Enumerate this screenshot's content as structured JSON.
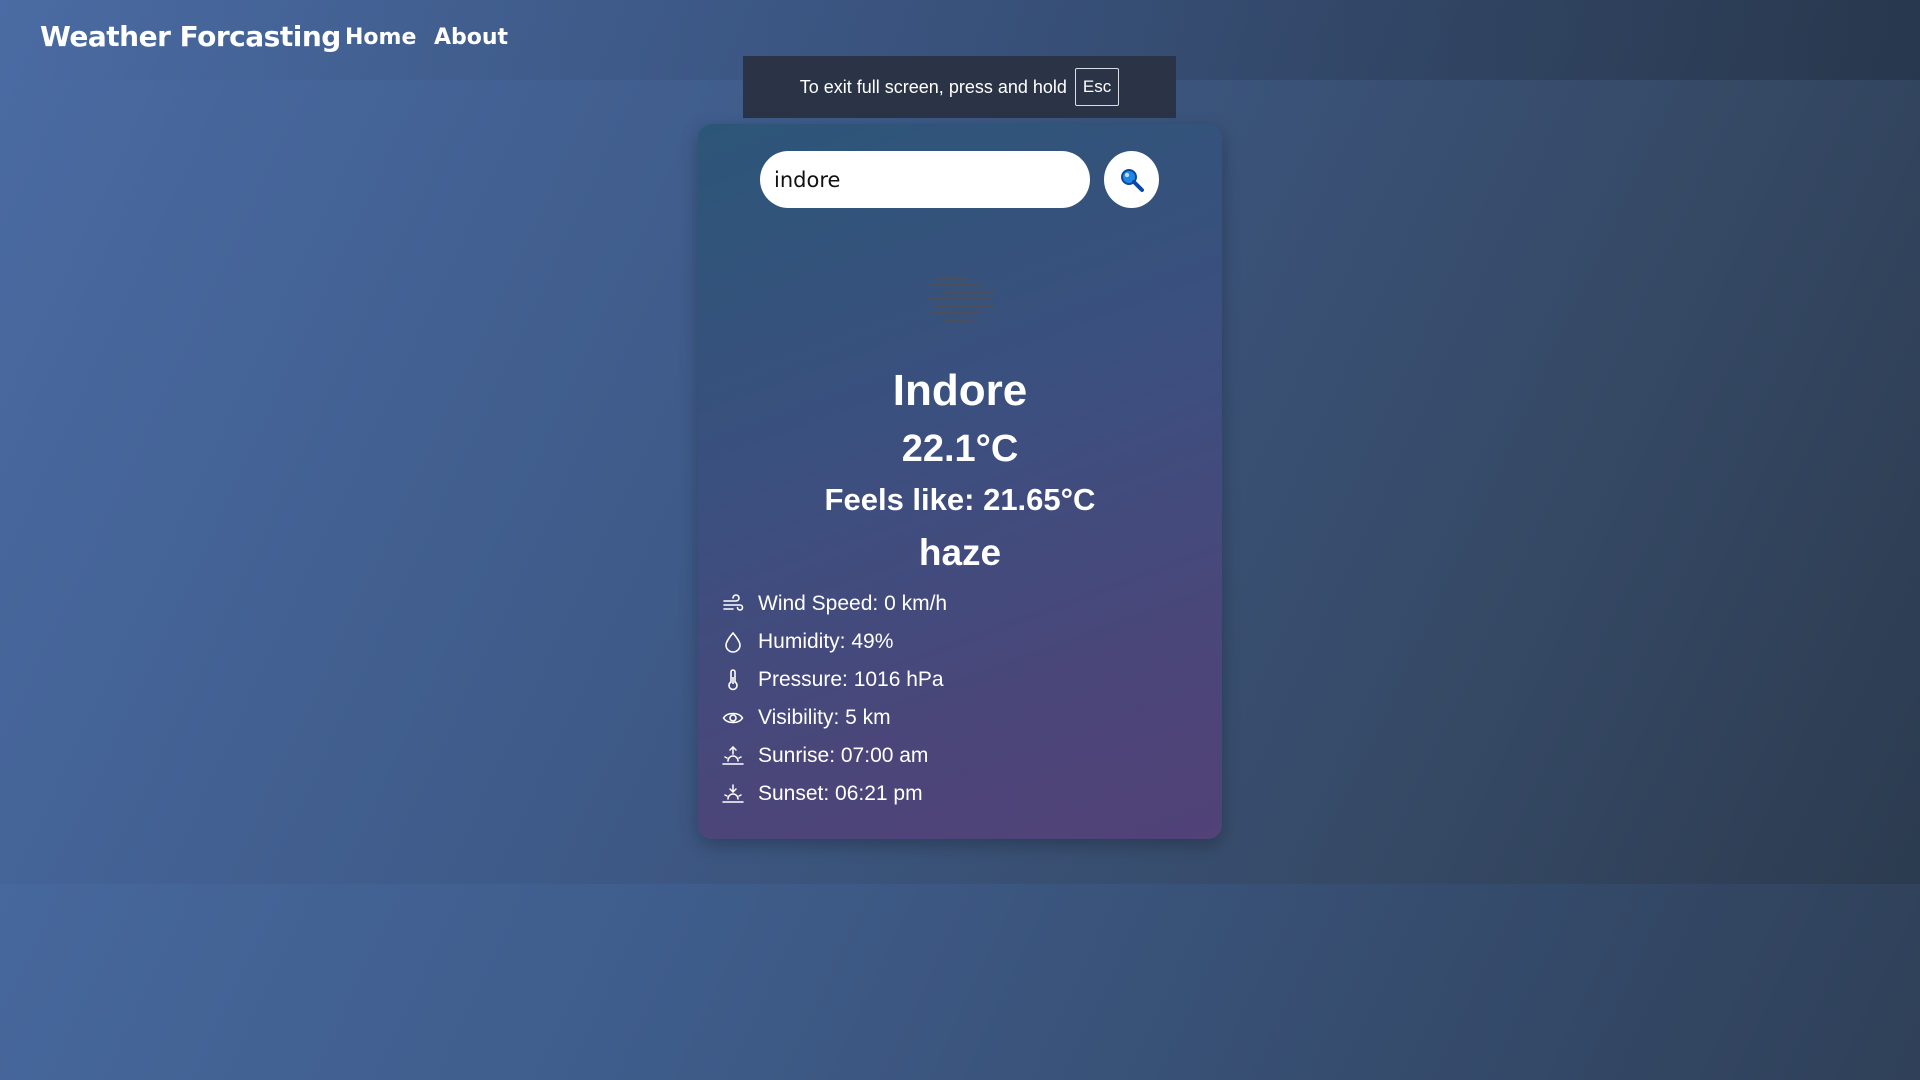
{
  "nav": {
    "brand": "Weather Forcasting",
    "home": "Home",
    "about": "About"
  },
  "toast": {
    "text": "To exit full screen, press and hold",
    "key": "Esc"
  },
  "search": {
    "value": "indore",
    "icon": "magnifier-icon"
  },
  "weather": {
    "icon": "haze-icon",
    "city": "Indore",
    "temp": "22.1°C",
    "feels_like": "Feels like: 21.65°C",
    "description": "haze"
  },
  "details": [
    {
      "icon": "wind-icon",
      "label": "Wind Speed: 0 km/h"
    },
    {
      "icon": "droplet-icon",
      "label": "Humidity: 49%"
    },
    {
      "icon": "thermometer-icon",
      "label": "Pressure: 1016 hPa"
    },
    {
      "icon": "eye-icon",
      "label": "Visibility: 5 km"
    },
    {
      "icon": "sunrise-icon",
      "label": "Sunrise: 07:00 am"
    },
    {
      "icon": "sunset-icon",
      "label": "Sunset: 06:21 pm"
    }
  ],
  "colors": {
    "card_top": "#2c5678",
    "card_bottom": "#514278",
    "search_icon_blue": "#1e88e5"
  }
}
